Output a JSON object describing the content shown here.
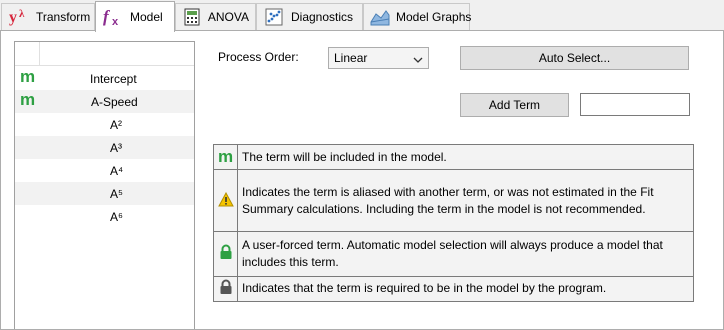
{
  "tabs": [
    {
      "label": "Transform",
      "icon": "lambda-icon",
      "active": false
    },
    {
      "label": "Model",
      "icon": "fx-icon",
      "active": true
    },
    {
      "label": "ANOVA",
      "icon": "calculator-icon",
      "active": false
    },
    {
      "label": "Diagnostics",
      "icon": "scatter-plot-icon",
      "active": false
    },
    {
      "label": "Model Graphs",
      "icon": "surface-graph-icon",
      "active": false
    }
  ],
  "terms": [
    {
      "marker": "m",
      "name": "Intercept"
    },
    {
      "marker": "m",
      "name": "A-Speed"
    },
    {
      "marker": "",
      "name": "A²"
    },
    {
      "marker": "",
      "name": "A³"
    },
    {
      "marker": "",
      "name": "A⁴"
    },
    {
      "marker": "",
      "name": "A⁵"
    },
    {
      "marker": "",
      "name": "A⁶"
    }
  ],
  "process_order": {
    "label": "Process Order:",
    "value": "Linear"
  },
  "buttons": {
    "auto_select": "Auto Select...",
    "add_term": "Add Term"
  },
  "add_term_value": "",
  "legend": [
    {
      "icon": "model-m-icon",
      "text": "The term will be included in the model."
    },
    {
      "icon": "warning-icon",
      "text": "Indicates the term is aliased with another term, or was not estimated in the Fit Summary calculations. Including the term in the model is not recommended."
    },
    {
      "icon": "green-lock-icon",
      "text": "A user-forced term. Automatic model selection will always produce a model that includes this term."
    },
    {
      "icon": "gray-lock-icon",
      "text": "Indicates that the term is required to be in the model by the program."
    }
  ],
  "legend_marker": "m",
  "colors": {
    "model_green": "#2ea043",
    "warning_yellow": "#f5c400",
    "lambda_red": "#d6263c",
    "fx_purple": "#8b2c8f"
  }
}
